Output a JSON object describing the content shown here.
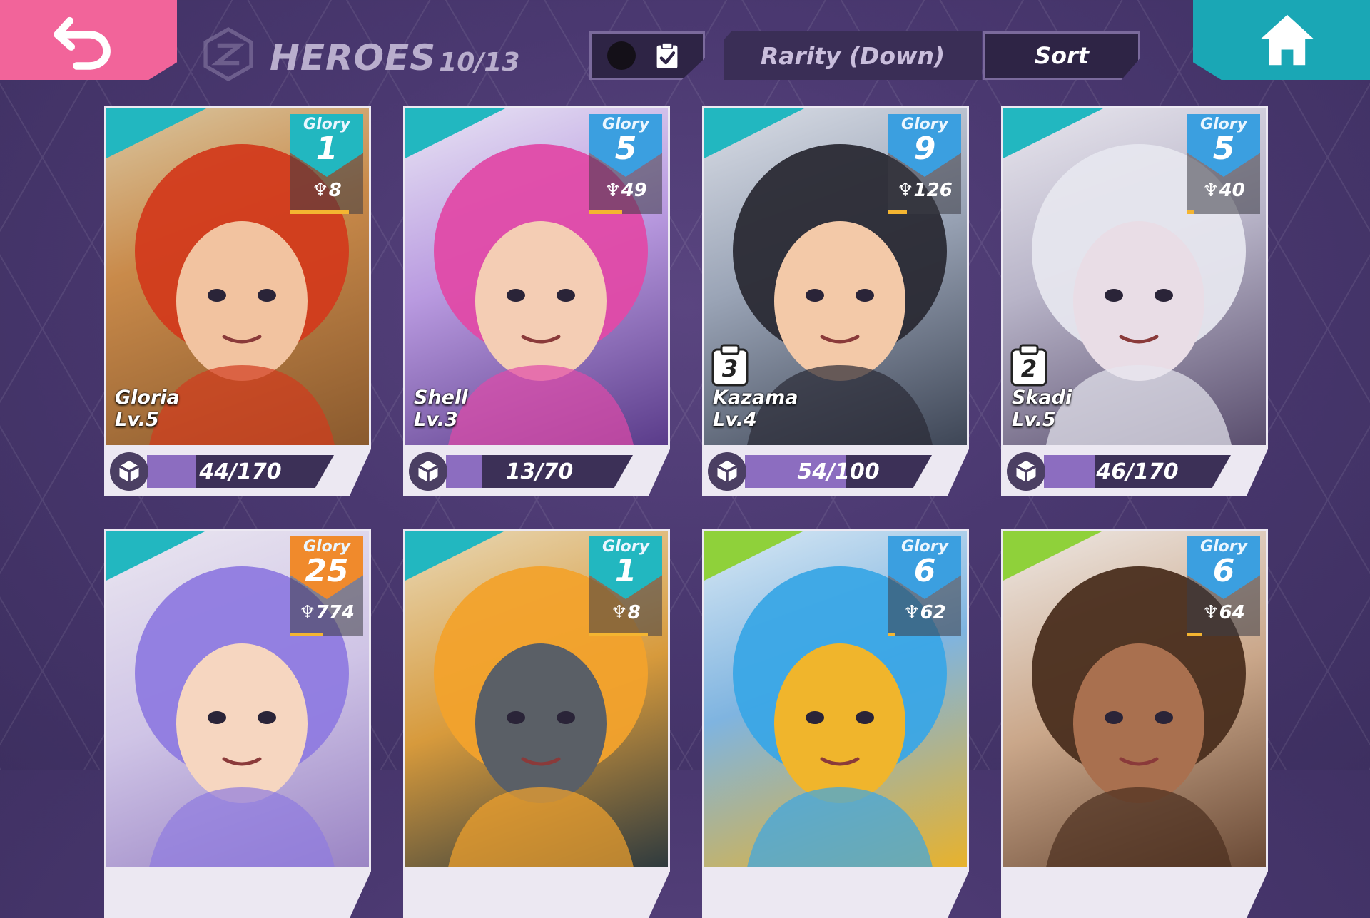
{
  "header": {
    "title": "HEROES",
    "count": "10/13",
    "rarity_label": "Rarity (Down)",
    "sort_label": "Sort"
  },
  "colors": {
    "back": "#f2649a",
    "home": "#1aa7b5",
    "glory_blue": "#3b9fe0",
    "glory_teal": "#22b7c0",
    "glory_orange": "#f08a2c"
  },
  "heroes": [
    {
      "name": "Gloria",
      "level": "Lv.5",
      "glory": "1",
      "trophies": "8",
      "shards": "44/170",
      "shard_fill": 0.26,
      "glory_color": "teal",
      "rank_badge": ""
    },
    {
      "name": "Shell",
      "level": "Lv.3",
      "glory": "5",
      "trophies": "49",
      "shards": "13/70",
      "shard_fill": 0.19,
      "glory_color": "blue",
      "rank_badge": ""
    },
    {
      "name": "Kazama",
      "level": "Lv.4",
      "glory": "9",
      "trophies": "126",
      "shards": "54/100",
      "shard_fill": 0.54,
      "glory_color": "blue",
      "rank_badge": "3"
    },
    {
      "name": "Skadi",
      "level": "Lv.5",
      "glory": "5",
      "trophies": "40",
      "shards": "46/170",
      "shard_fill": 0.27,
      "glory_color": "blue",
      "rank_badge": "2"
    },
    {
      "glory": "25",
      "trophies": "774",
      "glory_color": "orange"
    },
    {
      "glory": "1",
      "trophies": "8",
      "glory_color": "teal"
    },
    {
      "glory": "6",
      "trophies": "62",
      "glory_color": "blue"
    },
    {
      "glory": "6",
      "trophies": "64",
      "glory_color": "blue"
    }
  ]
}
